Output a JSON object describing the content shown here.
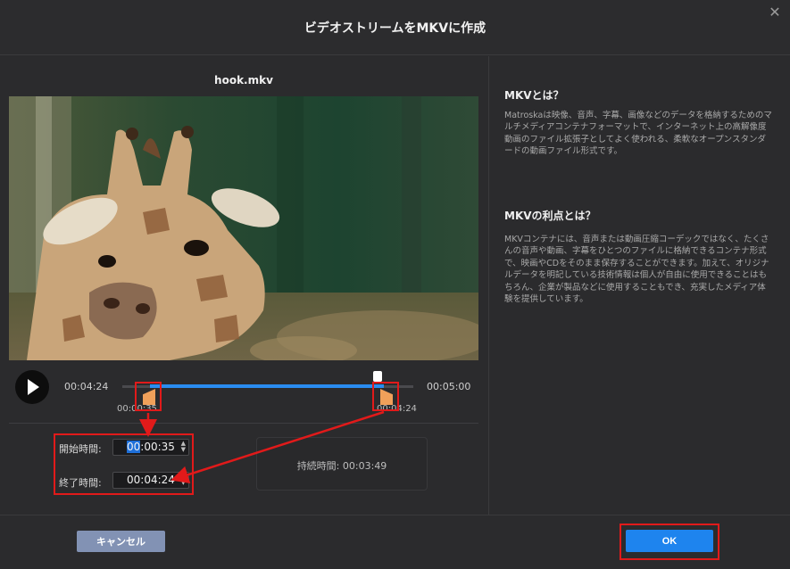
{
  "dialog": {
    "title": "ビデオストリームをMKVに作成",
    "close_symbol": "✕"
  },
  "preview": {
    "filename": "hook.mkv",
    "current_time": "00:04:24",
    "end_time": "00:05:00",
    "handle_start_label": "00:00:35",
    "handle_end_label": "00:04:24",
    "selection": {
      "start_fraction": 0.117,
      "end_fraction": 0.88
    },
    "playhead_fraction": 0.88
  },
  "trim": {
    "start_label": "開始時間:",
    "start_value_highlight": "00",
    "start_value_rest": ":00:35",
    "end_label": "終了時間:",
    "end_value": "00:04:24",
    "duration_label": "持続時間:",
    "duration_value": "00:03:49"
  },
  "info": {
    "section1_title": "MKVとは？",
    "section1_body": "Matroskaは映像、音声、字幕、画像などのデータを格納するためのマルチメディアコンテナフォーマットで、インターネット上の高解像度動画のファイル拡張子としてよく使われる、柔軟なオープンスタンダードの動画ファイル形式です。",
    "section2_title": "MKVの利点とは？",
    "section2_body": "MKVコンテナには、音声または動画圧縮コーデックではなく、たくさんの音声や動画、字幕をひとつのファイルに格納できるコンテナ形式で、映画やCDをそのまま保存することができます。加えて、オリジナルデータを明記している技術情報は個人が自由に使用できることはもちろん、企業が製品などに使用することもでき、充実したメディア体験を提供しています。"
  },
  "footer": {
    "cancel_label": "キャンセル",
    "ok_label": "OK"
  },
  "colors": {
    "accent": "#1e84ee",
    "annotation_red": "#e11a1a",
    "handle_orange": "#f0a05a",
    "background": "#2b2b2d"
  }
}
